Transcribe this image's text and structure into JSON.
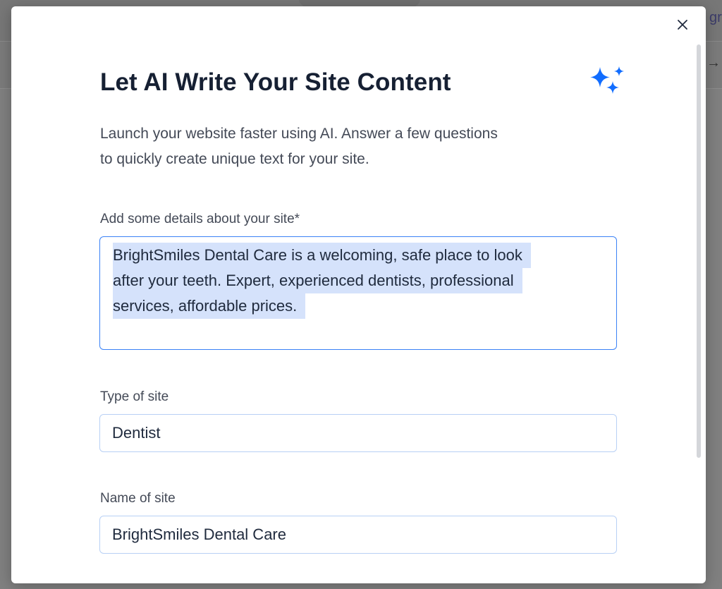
{
  "background": {
    "edge_text": "gr",
    "edge_arrow": "→"
  },
  "modal": {
    "close_icon": "close-icon",
    "sparkles_icon": "sparkles-icon",
    "title": "Let AI Write Your Site Content",
    "subtitle_lines": [
      "Launch your website faster using AI. Answer a few questions",
      "to quickly create unique text for your site."
    ],
    "details": {
      "label": "Add some details about your site*",
      "value_lines": [
        "BrightSmiles Dental Care is a welcoming, safe place to look",
        "after your teeth. Expert, experienced dentists, professional",
        "services, affordable prices."
      ]
    },
    "site_type": {
      "label": "Type of site",
      "value": "Dentist"
    },
    "site_name": {
      "label": "Name of site",
      "value": "BrightSmiles Dental Care"
    }
  },
  "colors": {
    "accent": "#116dff",
    "title": "#162033",
    "focus_border": "#3b82f6",
    "selection": "#d5e2fb"
  }
}
